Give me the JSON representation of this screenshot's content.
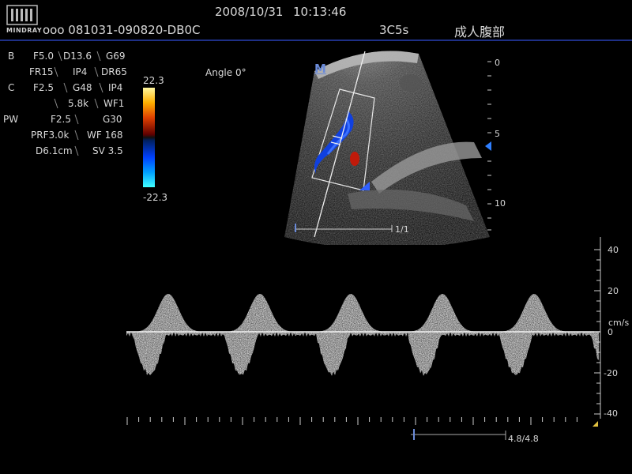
{
  "header": {
    "brand": "MINDRAY",
    "date": "2008/10/31",
    "time": "10:13:46",
    "patient_id": "ooo 081031-090820-DB0C",
    "probe": "3C5s",
    "exam": "成人腹部"
  },
  "params": {
    "b_label": "B",
    "b_row1": [
      "F5.0",
      "D13.6",
      "G69"
    ],
    "b_row2": [
      "FR15",
      "IP4",
      "DR65"
    ],
    "c_label": "C",
    "c_row1": [
      "F2.5",
      "G48",
      "IP4"
    ],
    "c_row2": [
      "",
      "5.8k",
      "WF1"
    ],
    "pw_label": "PW",
    "pw_row1": [
      "F2.5",
      "G30"
    ],
    "pw_row2": [
      "PRF3.0k",
      "WF 168"
    ],
    "pw_row3": [
      "D6.1cm",
      "SV 3.5"
    ]
  },
  "color_bar": {
    "top": "22.3",
    "bottom": "-22.3"
  },
  "angle": "Angle 0°",
  "image_marker": "M",
  "depth_scale": {
    "labels": [
      "0",
      "5",
      "10"
    ],
    "values": [
      0,
      5,
      10
    ]
  },
  "image_ratio": "1/1",
  "spectrum": {
    "unit": "cm/s",
    "axis_labels": [
      "40",
      "20",
      "0",
      "-20",
      "-40"
    ],
    "axis_values": [
      40,
      20,
      0,
      -20,
      -40
    ],
    "ratio": "4.8/4.8"
  },
  "colors": {
    "accent": "#1e2f86",
    "marker": "#6a8ad8"
  }
}
